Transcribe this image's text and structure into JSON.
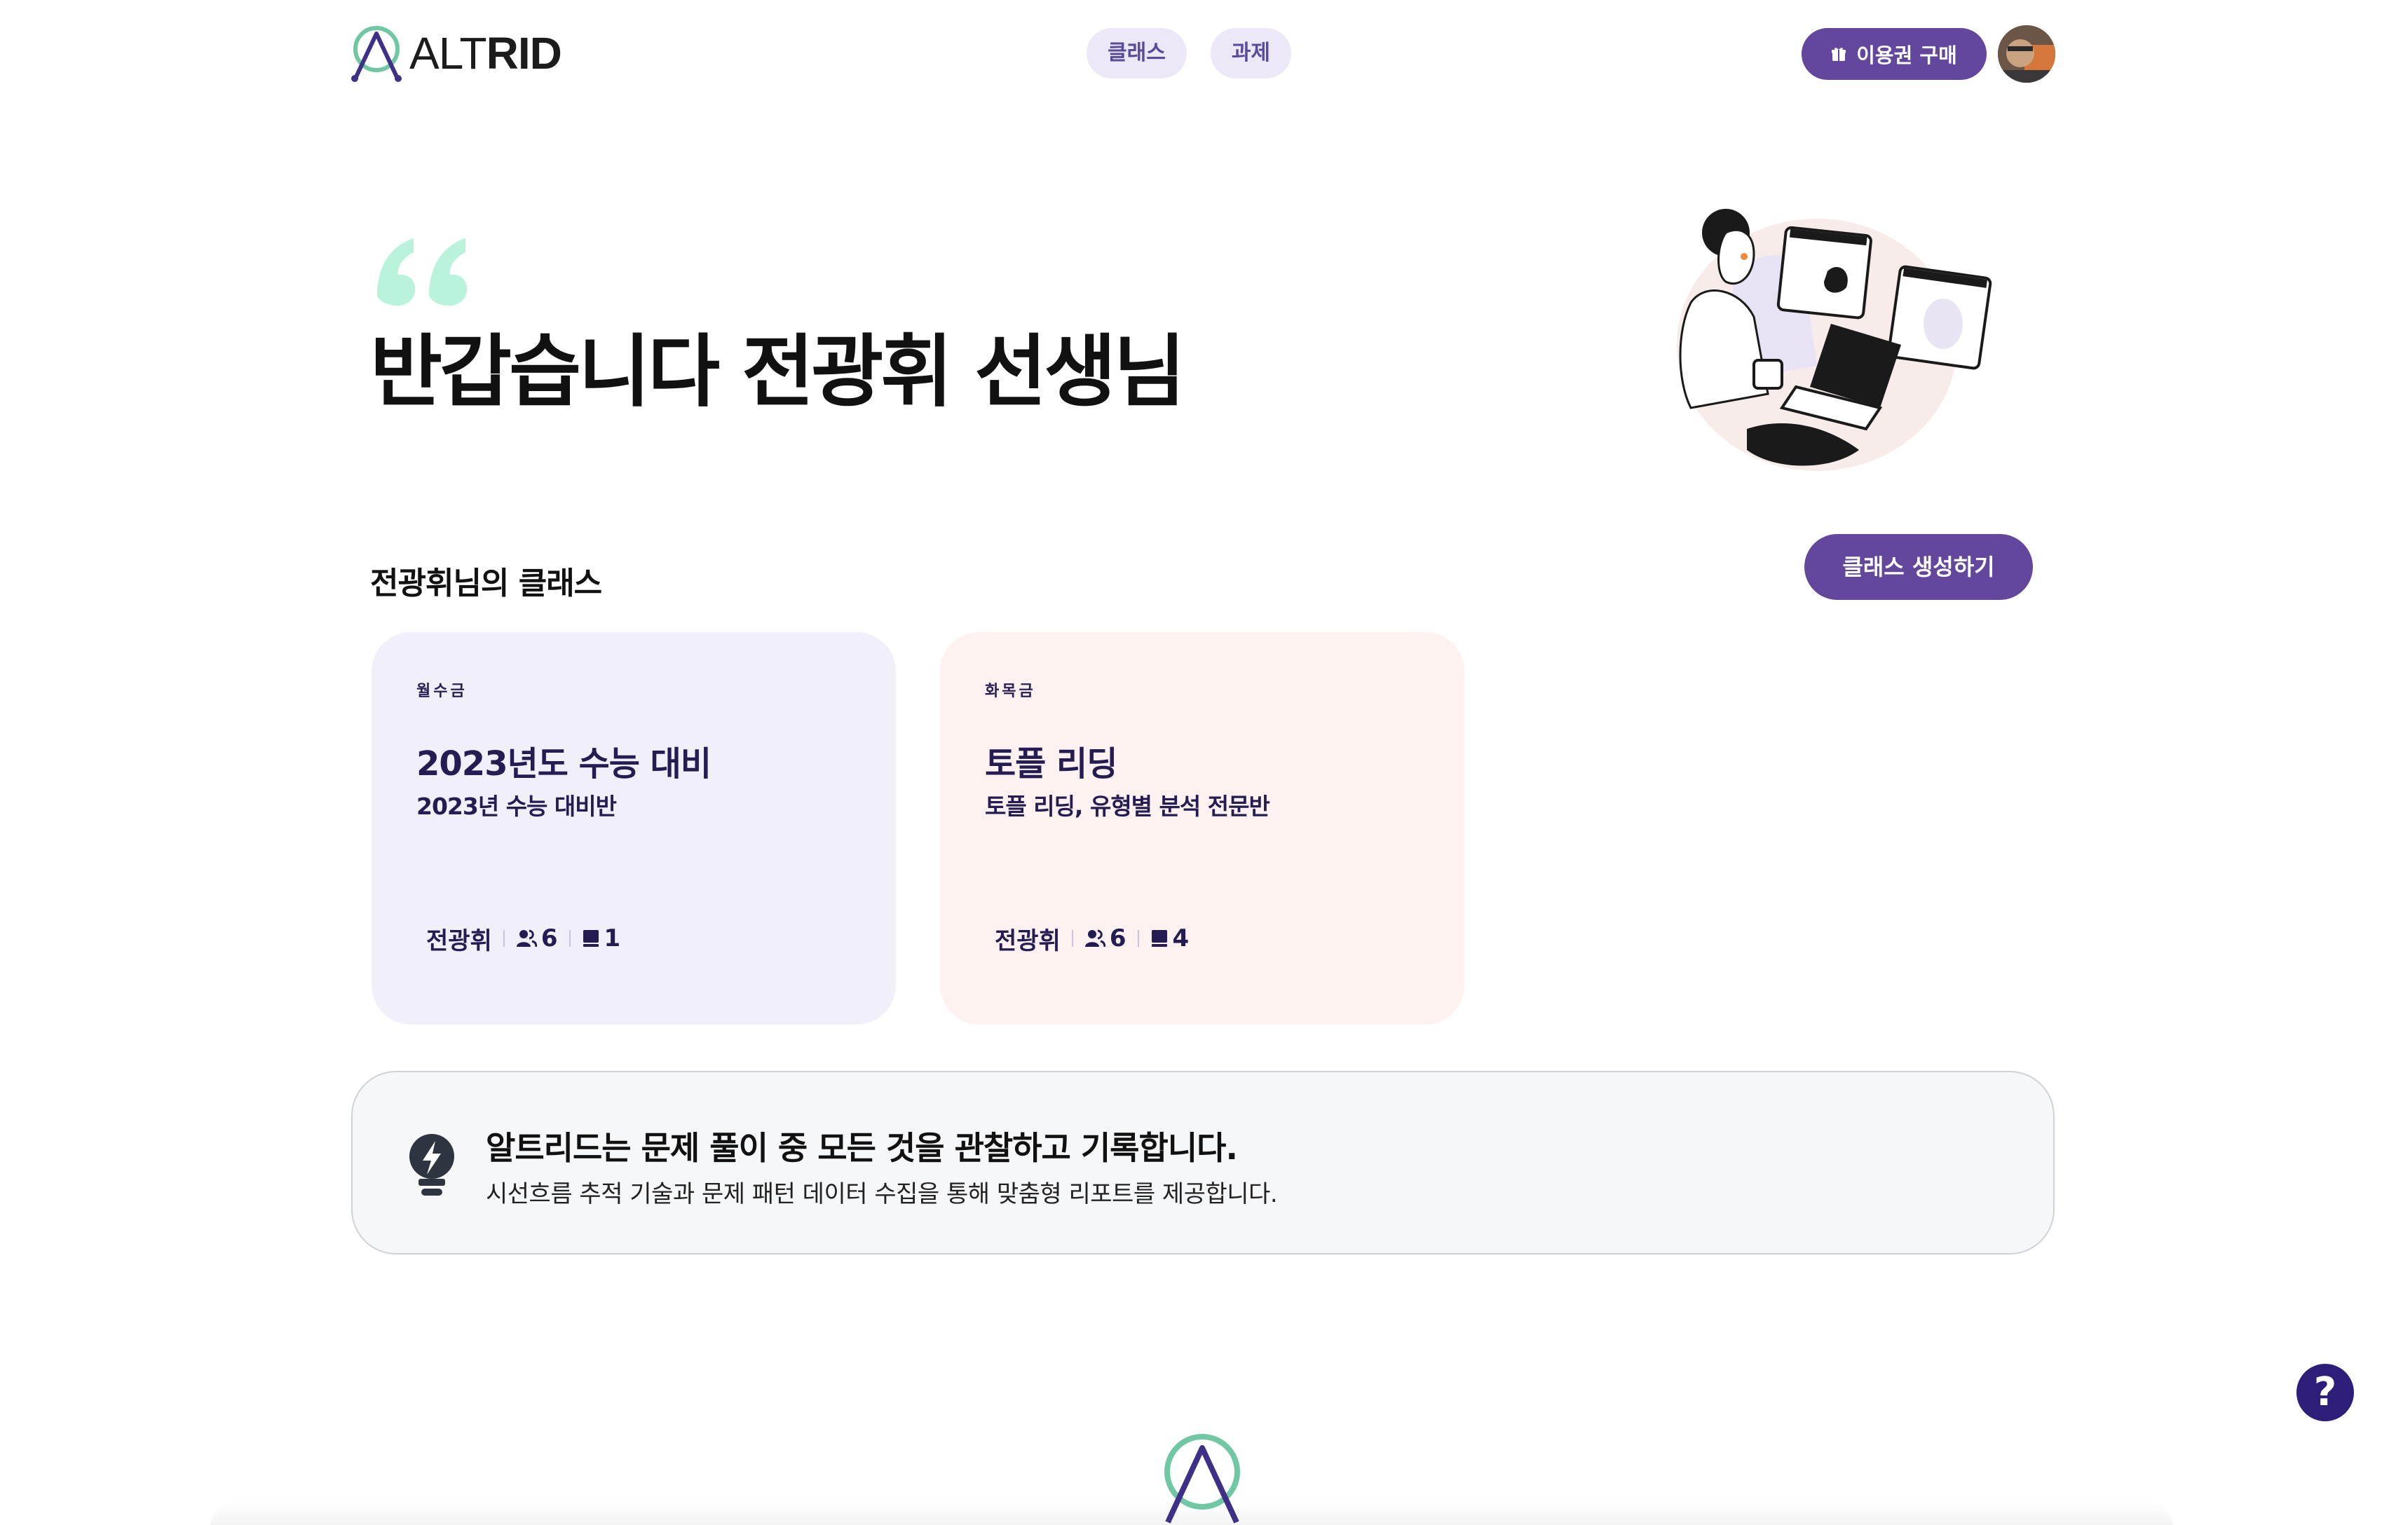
{
  "header": {
    "logo_text_light": "ALT",
    "logo_text_bold": "RID",
    "nav": [
      {
        "label": "클래스"
      },
      {
        "label": "과제"
      }
    ],
    "buy_button_label": "이용권 구매"
  },
  "hero": {
    "greeting": "반갑습니다 전광휘 선생님"
  },
  "classes": {
    "section_title": "전광휘님의 클래스",
    "create_button_label": "클래스 생성하기",
    "items": [
      {
        "days": "월수금",
        "title": "2023년도 수능 대비",
        "subtitle": "2023년 수능 대비반",
        "teacher": "전광휘",
        "students": "6",
        "assignments": "1"
      },
      {
        "days": "화목금",
        "title": "토플 리딩",
        "subtitle": "토플 리딩, 유형별 분석 전문반",
        "teacher": "전광휘",
        "students": "6",
        "assignments": "4"
      }
    ]
  },
  "banner": {
    "title": "알트리드는 문제 풀이 중 모든 것을 관찰하고 기록합니다.",
    "subtitle": "시선흐름 추적 기술과 문제 패턴 데이터 수집을 통해 맞춤형 리포트를 제공합니다."
  },
  "help": {
    "label": "?"
  },
  "colors": {
    "primary": "#62479c",
    "nav_pill_bg": "#ece8f8",
    "card_purple_bg": "#f1effa",
    "card_pink_bg": "#fdf2f0",
    "quote_mint": "#b9f3dc",
    "help_bg": "#2e1e7a"
  },
  "icons": [
    "altrid-logo-icon",
    "gift-icon",
    "quote-icon",
    "students-icon",
    "book-icon",
    "lightbulb-icon",
    "help-icon"
  ]
}
